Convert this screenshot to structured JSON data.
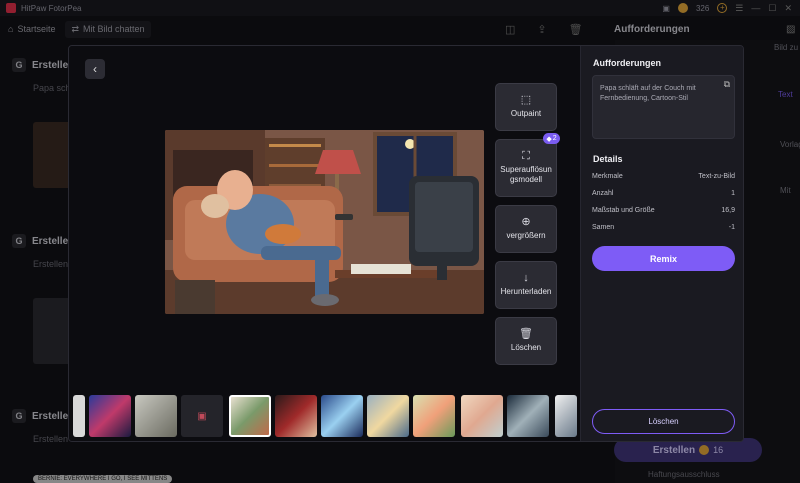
{
  "app": {
    "title": "HitPaw FotorPea",
    "credits": "326"
  },
  "topbar": {
    "home_label": "Startseite",
    "chat_label": "Mit Bild chatten",
    "right_header": "Aufforderungen"
  },
  "feed": {
    "items": [
      {
        "title": "Erstellen",
        "subtitle": "Papa sch"
      },
      {
        "title": "Erstellen",
        "subtitle": "Erstellen"
      },
      {
        "title": "Erstellen",
        "subtitle": "Erstellen"
      }
    ],
    "caption_pill": "BERNIE: EVERYWHERE I GO, I SEE MITTENS",
    "side_labels": [
      "Bild zu",
      "Text",
      "Vorlag",
      "Mit"
    ],
    "create_button": "Erstellen",
    "create_cost": "16",
    "note": "Haftungsausschluss"
  },
  "modal": {
    "tools": [
      {
        "label": "Outpaint",
        "icon": "outpaint-icon"
      },
      {
        "label": "Superauflösun gsmodell",
        "icon": "super-resolution-icon",
        "badge": "2"
      },
      {
        "label": "vergrößern",
        "icon": "zoom-in-icon"
      },
      {
        "label": "Herunterladen",
        "icon": "download-icon"
      },
      {
        "label": "Löschen",
        "icon": "trash-icon"
      }
    ],
    "panel": {
      "prompts_heading": "Aufforderungen",
      "prompt_text": "Papa schläft auf der Couch mit Fernbedienung, Cartoon-Stil",
      "details_heading": "Details",
      "details": [
        {
          "key": "Merkmale",
          "value": "Text-zu-Bild"
        },
        {
          "key": "Anzahl",
          "value": "1"
        },
        {
          "key": "Maßstab und Größe",
          "value": "16,9"
        },
        {
          "key": "Samen",
          "value": "-1"
        }
      ],
      "remix_label": "Remix",
      "delete_label": "Löschen"
    }
  },
  "colors": {
    "accent": "#7e5cf6",
    "panel_bg": "#1a1a21",
    "stage_bg": "#0c0c10"
  }
}
